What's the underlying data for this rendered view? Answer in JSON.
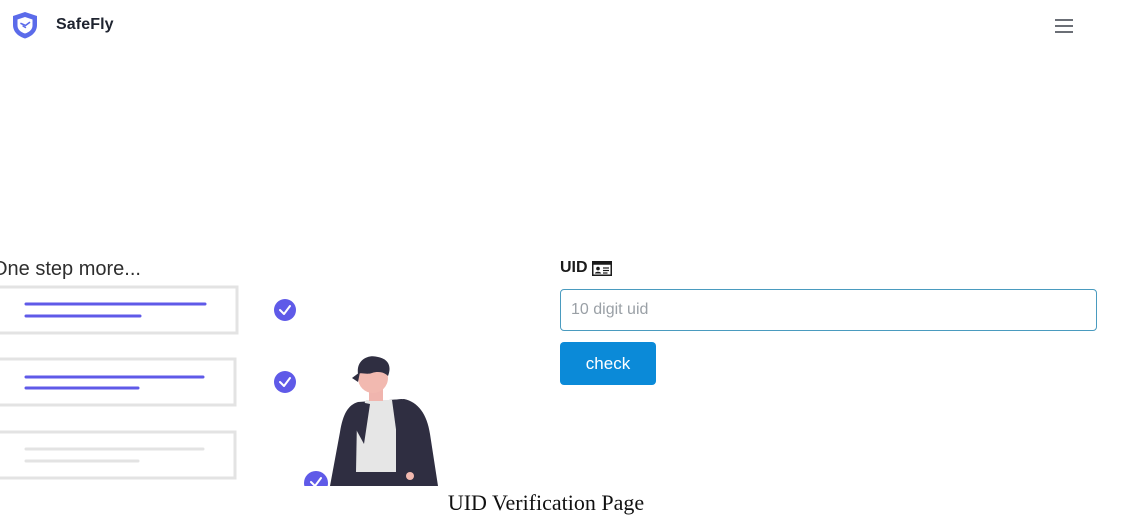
{
  "header": {
    "brand_name": "SafeFly",
    "logo_icon": "shield-logo-icon",
    "menu_icon": "hamburger-menu-icon"
  },
  "illustration": {
    "title": "One step more...",
    "checklist_items": [
      {
        "status": "checked"
      },
      {
        "status": "checked"
      },
      {
        "status": "checked"
      }
    ]
  },
  "form": {
    "uid_label": "UID",
    "uid_icon": "id-card-icon",
    "uid_input": {
      "value": "",
      "placeholder": "10 digit uid"
    },
    "check_button_label": "check"
  },
  "caption": "UID Verification Page",
  "colors": {
    "accent": "#0b8ad8",
    "brand_shield": "#5b6bea",
    "check_badge": "#5f5ae8",
    "input_border": "#4a9bbf"
  }
}
